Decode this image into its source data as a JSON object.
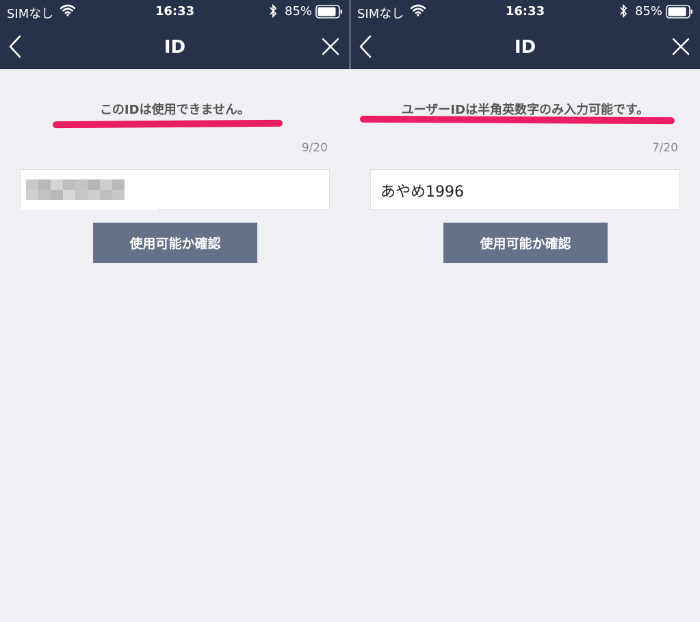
{
  "status_bar": {
    "carrier": "SIMなし",
    "time": "16:33",
    "battery": "85%"
  },
  "screens": [
    {
      "title": "ID",
      "error_message": "このIDは使用できません。",
      "char_count": "9/20",
      "input_value": "",
      "input_obscured": true,
      "check_button": "使用可能か確認"
    },
    {
      "title": "ID",
      "error_message": "ユーザーIDは半角英数字のみ入力可能です。",
      "char_count": "7/20",
      "input_value": "あやめ1996",
      "input_obscured": false,
      "check_button": "使用可能か確認"
    }
  ],
  "colors": {
    "header_bg": "#27314a",
    "highlight": "#ea1e63",
    "button_bg": "#677089",
    "page_bg": "#f0f0f4"
  },
  "icons": [
    "wifi-icon",
    "bluetooth-icon",
    "battery-icon",
    "back-icon",
    "close-icon"
  ]
}
